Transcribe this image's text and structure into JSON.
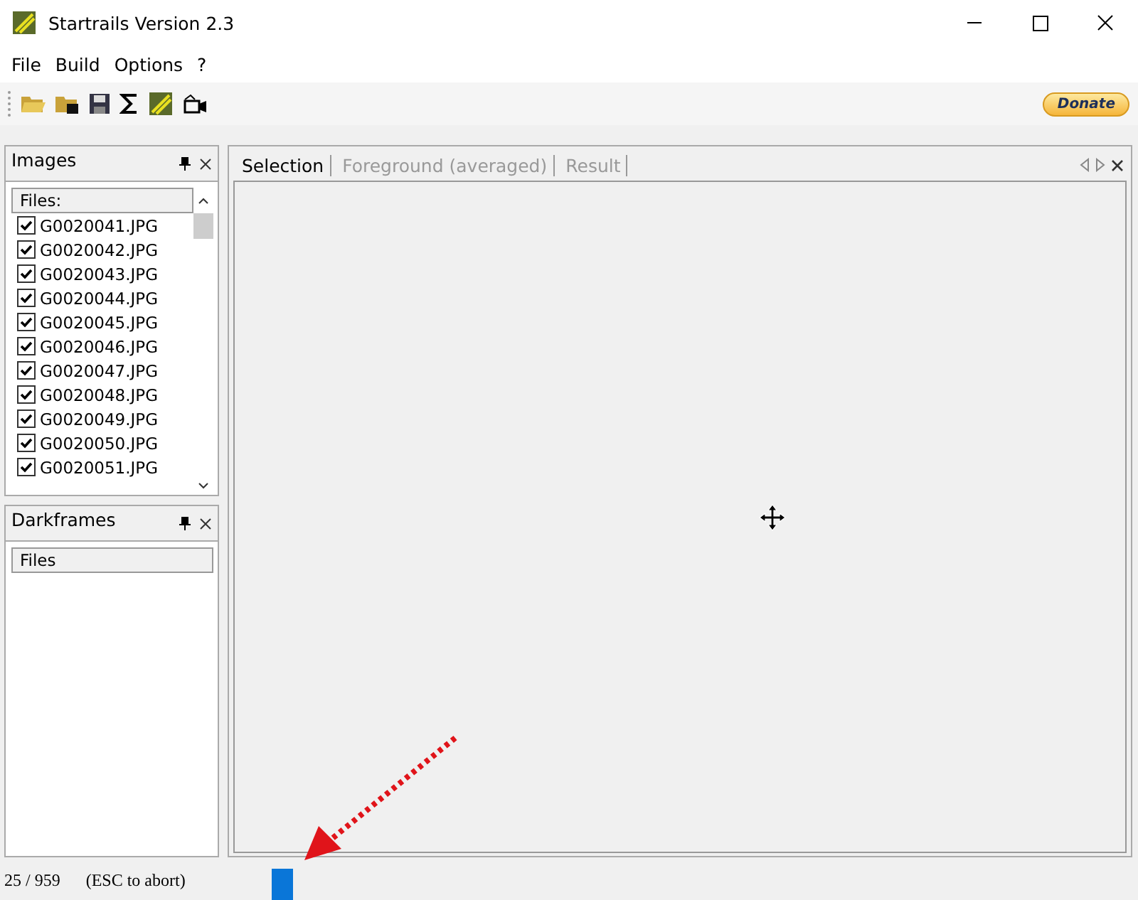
{
  "window": {
    "title": "Startrails Version 2.3"
  },
  "menu": [
    "File",
    "Build",
    "Options",
    "?"
  ],
  "toolbar": {
    "donate": "Donate"
  },
  "images_panel": {
    "title": "Images",
    "column": "Files:",
    "files": [
      {
        "name": "G0020041.JPG",
        "checked": true
      },
      {
        "name": "G0020042.JPG",
        "checked": true
      },
      {
        "name": "G0020043.JPG",
        "checked": true
      },
      {
        "name": "G0020044.JPG",
        "checked": true
      },
      {
        "name": "G0020045.JPG",
        "checked": true
      },
      {
        "name": "G0020046.JPG",
        "checked": true
      },
      {
        "name": "G0020047.JPG",
        "checked": true
      },
      {
        "name": "G0020048.JPG",
        "checked": true
      },
      {
        "name": "G0020049.JPG",
        "checked": true
      },
      {
        "name": "G0020050.JPG",
        "checked": true
      },
      {
        "name": "G0020051.JPG",
        "checked": true
      }
    ]
  },
  "darkframes_panel": {
    "title": "Darkframes",
    "column": "Files"
  },
  "tabs": [
    {
      "label": "Selection",
      "selected": true
    },
    {
      "label": "Foreground (averaged)",
      "selected": false
    },
    {
      "label": "Result",
      "selected": false
    }
  ],
  "status_bar": {
    "count": "25 / 959",
    "hint": "(ESC to abort)"
  }
}
